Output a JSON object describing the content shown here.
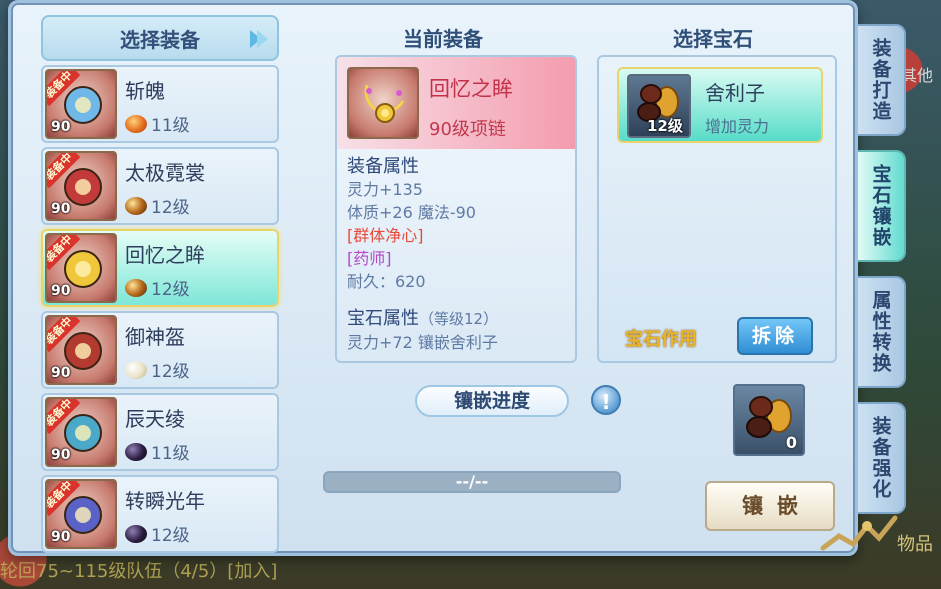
{
  "select_equipment": {
    "title": "选择装备",
    "items": [
      {
        "name": "斩魄",
        "level_badge": "90",
        "equipped_badge": "装备中",
        "gem_level": "11级",
        "gem_kind": "red"
      },
      {
        "name": "太极霓裳",
        "level_badge": "90",
        "equipped_badge": "装备中",
        "gem_level": "12级",
        "gem_kind": "amber"
      },
      {
        "name": "回忆之眸",
        "level_badge": "90",
        "equipped_badge": "装备中",
        "gem_level": "12级",
        "gem_kind": "amber",
        "selected": true
      },
      {
        "name": "御神盔",
        "level_badge": "90",
        "equipped_badge": "装备中",
        "gem_level": "12级",
        "gem_kind": "pearl"
      },
      {
        "name": "辰天绫",
        "level_badge": "90",
        "equipped_badge": "装备中",
        "gem_level": "11级",
        "gem_kind": "dark"
      },
      {
        "name": "转瞬光年",
        "level_badge": "90",
        "equipped_badge": "装备中",
        "gem_level": "12级",
        "gem_kind": "dark"
      }
    ]
  },
  "current_equipment": {
    "title": "当前装备",
    "name": "回忆之眸",
    "type": "90级项链",
    "equip_attr_title": "装备属性",
    "lines": [
      "灵力+135",
      "体质+26 魔法-90"
    ],
    "special_red": "[群体净心]",
    "special_purple": "[药师]",
    "durability": "耐久：620",
    "gem_attr_title": "宝石属性",
    "gem_attr_level": "（等级12）",
    "gem_attr_line": "灵力+72 镶嵌舍利子"
  },
  "inlay_progress": {
    "label": "镶嵌进度",
    "info_icon": "!",
    "value_text": "--/--",
    "fill_fraction": 0.0
  },
  "select_gem": {
    "title": "选择宝石",
    "gem_name": "舍利子",
    "gem_level": "12级",
    "gem_desc": "增加灵力",
    "effect_label": "宝石作用",
    "remove_label": "拆除"
  },
  "gem_slot": {
    "count": "0"
  },
  "inlay_button": "镶嵌",
  "side_tabs": [
    {
      "label": "装备打造",
      "active": false
    },
    {
      "label": "宝石镶嵌",
      "active": true
    },
    {
      "label": "属性转换",
      "active": false
    },
    {
      "label": "装备强化",
      "active": false
    }
  ],
  "background": {
    "bottom_text": "轮回75~115级队伍（4/5）[加入]",
    "right_text_top": "其他",
    "right_text_bottom": "物品"
  },
  "colors": {
    "selected_teal": "#62dbd0",
    "equipped_red": "#d9332b",
    "name_red": "#c2314a",
    "effect_gold": "#e8b52a",
    "button_blue": "#2f8ed3"
  }
}
